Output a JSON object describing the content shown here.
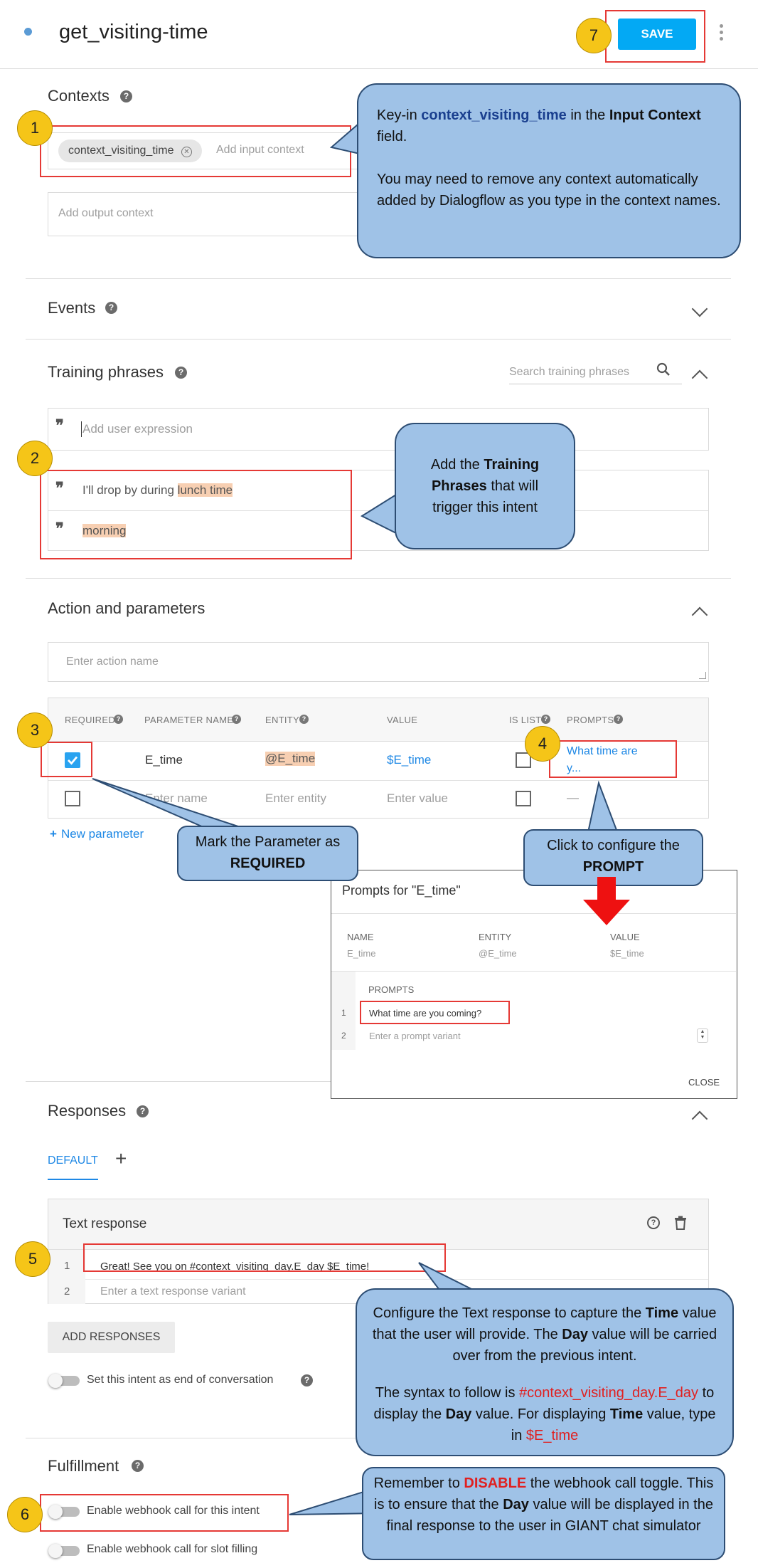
{
  "header": {
    "intent_name": "get_visiting-time",
    "save_label": "SAVE",
    "more_icon": "more-vert-icon"
  },
  "contexts": {
    "title": "Contexts",
    "input_chip": "context_visiting_time",
    "input_placeholder": "Add input context",
    "output_placeholder": "Add output context"
  },
  "events": {
    "title": "Events"
  },
  "training": {
    "title": "Training phrases",
    "search_placeholder": "Search training phrases",
    "add_placeholder": "Add user expression",
    "phrases": [
      {
        "prefix": "I'll drop by during ",
        "highlight": "lunch time"
      },
      {
        "prefix": "",
        "highlight": "morning"
      }
    ]
  },
  "action": {
    "title": "Action and parameters",
    "action_placeholder": "Enter action name",
    "headers": [
      "REQUIRED",
      "PARAMETER NAME",
      "ENTITY",
      "VALUE",
      "IS LIST",
      "PROMPTS"
    ],
    "row1": {
      "name": "E_time",
      "entity": "@E_time",
      "value": "$E_time",
      "prompt": "What time are y..."
    },
    "row2": {
      "name": "Enter name",
      "entity": "Enter entity",
      "value": "Enter value",
      "prompt": "—"
    },
    "new_param": "New parameter"
  },
  "prompts_dialog": {
    "title": "Prompts for \"E_time\"",
    "col_name": "NAME",
    "col_entity": "ENTITY",
    "col_value": "VALUE",
    "name": "E_time",
    "entity": "@E_time",
    "value": "$E_time",
    "prompts_label": "PROMPTS",
    "row1_num": "1",
    "row1": "What time are you coming?",
    "row2_num": "2",
    "row2": "Enter a prompt variant",
    "close": "CLOSE"
  },
  "responses": {
    "title": "Responses",
    "tab_default": "DEFAULT",
    "text_response_title": "Text response",
    "row1_num": "1",
    "row1": "Great! See you on #context_visiting_day.E_day $E_time!",
    "row2_num": "2",
    "row2": "Enter a text response variant",
    "add_button": "ADD RESPONSES",
    "end_conversation": "Set this intent as end of conversation"
  },
  "fulfillment": {
    "title": "Fulfillment",
    "webhook_intent": "Enable webhook call for this intent",
    "webhook_slot": "Enable webhook call for slot filling"
  },
  "annotations": {
    "badges": [
      "1",
      "2",
      "3",
      "4",
      "5",
      "6",
      "7"
    ],
    "c1_a": "Key-in ",
    "c1_b": "context_visiting_time",
    "c1_c": " in the ",
    "c1_d": "Input Context",
    "c1_e": " field.",
    "c1_f": "You may need to remove any context automatically added by Dialogflow as you type in the context names.",
    "c2_a": "Add the ",
    "c2_b": "Training Phrases",
    "c2_c": " that will trigger this intent",
    "c3_a": "Mark the Parameter as ",
    "c3_b": "REQUIRED",
    "c4_a": "Click to configure the ",
    "c4_b": "PROMPT",
    "c5_a": "Configure the Text response to capture the ",
    "c5_b": "Time",
    "c5_c": " value that the user will provide. The ",
    "c5_d": "Day",
    "c5_e": " value will be carried over from the previous intent.",
    "c5_f": "The syntax to follow is ",
    "c5_g": "#context_visiting_day.E_day",
    "c5_h": " to display the ",
    "c5_i": "Day",
    "c5_j": " value. For displaying ",
    "c5_k": "Time",
    "c5_l": " value, type in ",
    "c5_m": "$E_time",
    "c6_a": "Remember to ",
    "c6_b": "DISABLE",
    "c6_c": " the webhook call toggle. This is to ensure that the ",
    "c6_d": "Day",
    "c6_e": " value will be displayed in the final response to the user in GIANT chat simulator"
  },
  "colors": {
    "save_blue": "#03a9f4",
    "link_blue": "#1e88e5",
    "highlight": "#f7cfb2",
    "callout": "#9fc2e7",
    "badge": "#f5c518",
    "annotation_red": "#e53935"
  }
}
